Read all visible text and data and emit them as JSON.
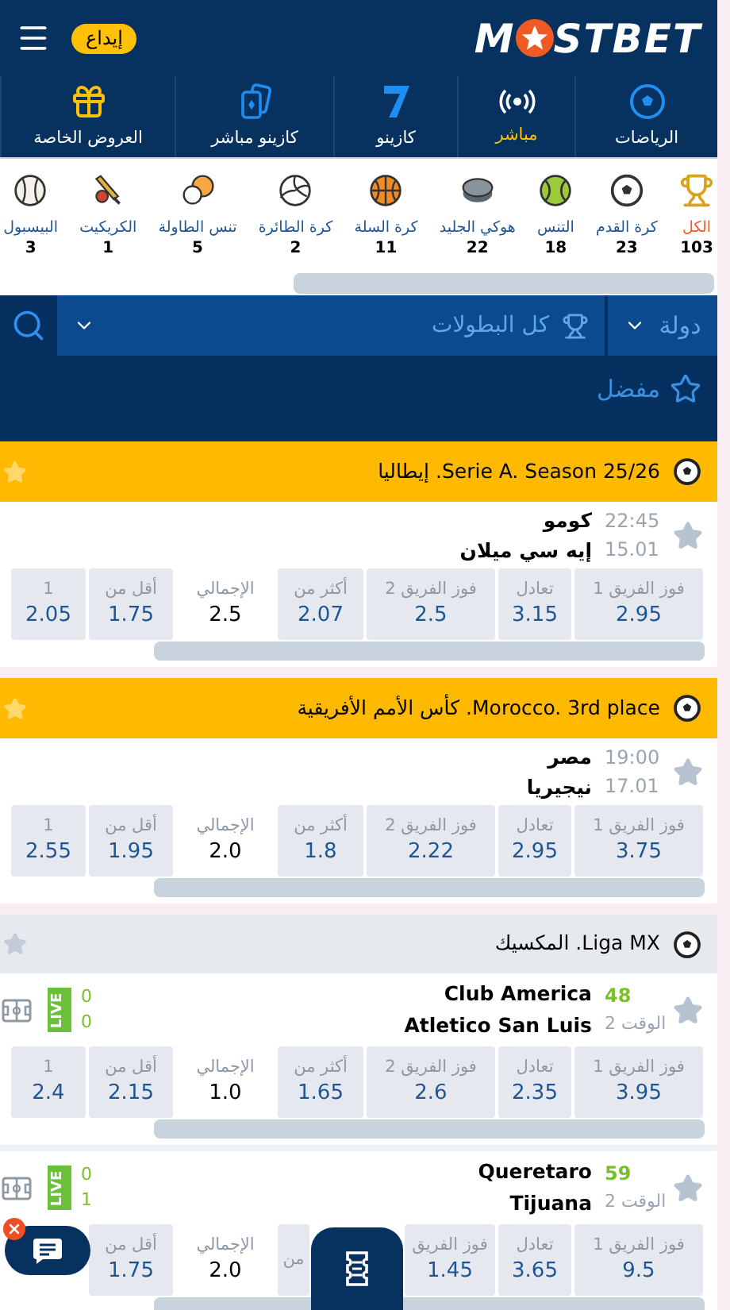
{
  "header": {
    "logo_left": "M",
    "logo_right": "STBET",
    "deposit_button": "إيداع"
  },
  "nav": [
    {
      "label": "الرياضات",
      "kind": "ball",
      "selected": false
    },
    {
      "label": "مباشر",
      "kind": "live",
      "selected": true
    },
    {
      "label": "كازينو",
      "kind": "seven",
      "selected": false
    },
    {
      "label": "كازينو مباشر",
      "kind": "cards",
      "selected": false
    },
    {
      "label": "العروض الخاصة",
      "kind": "gift",
      "selected": false
    }
  ],
  "sports": [
    {
      "label": "الكل",
      "count": "103",
      "kind": "trophy",
      "selected": true
    },
    {
      "label": "كرة القدم",
      "count": "23",
      "kind": "football",
      "selected": false
    },
    {
      "label": "التنس",
      "count": "18",
      "kind": "tennis",
      "selected": false
    },
    {
      "label": "هوكي الجليد",
      "count": "22",
      "kind": "hockey",
      "selected": false
    },
    {
      "label": "كرة السلة",
      "count": "11",
      "kind": "basketball",
      "selected": false
    },
    {
      "label": "كرة الطائرة",
      "count": "2",
      "kind": "volleyball",
      "selected": false
    },
    {
      "label": "تنس الطاولة",
      "count": "5",
      "kind": "pingpong",
      "selected": false
    },
    {
      "label": "الكريكيت",
      "count": "1",
      "kind": "cricket",
      "selected": false
    },
    {
      "label": "البيسبول",
      "count": "3",
      "kind": "baseball",
      "selected": false
    }
  ],
  "filters": {
    "country": "دولة",
    "tournaments": "كل البطولات"
  },
  "favorites": "مفضل",
  "leagues": [
    {
      "title": "Serie A. Season 25/26. إيطاليا",
      "highlight": true,
      "matches": [
        {
          "kind": "prematch",
          "time": "22:45",
          "date": "15.01",
          "team1": "كومو",
          "team2": "إيه سي ميلان",
          "odds": [
            {
              "label": "فوز الفريق 1",
              "value": "2.95",
              "kind": "odd"
            },
            {
              "label": "تعادل",
              "value": "3.15",
              "kind": "odd"
            },
            {
              "label": "فوز الفريق 2",
              "value": "2.5",
              "kind": "odd"
            },
            {
              "label": "أكثر من",
              "value": "2.07",
              "kind": "odd"
            },
            {
              "label": "الإجمالي",
              "value": "2.5",
              "kind": "total"
            },
            {
              "label": "أقل من",
              "value": "1.75",
              "kind": "odd"
            },
            {
              "label": "1",
              "value": "2.05",
              "kind": "odd"
            }
          ]
        }
      ]
    },
    {
      "title": "Morocco. 3rd place. كأس الأمم الأفريقية",
      "highlight": true,
      "matches": [
        {
          "kind": "prematch",
          "time": "19:00",
          "date": "17.01",
          "team1": "مصر",
          "team2": "نيجيريا",
          "odds": [
            {
              "label": "فوز الفريق 1",
              "value": "3.75",
              "kind": "odd"
            },
            {
              "label": "تعادل",
              "value": "2.95",
              "kind": "odd"
            },
            {
              "label": "فوز الفريق 2",
              "value": "2.22",
              "kind": "odd"
            },
            {
              "label": "أكثر من",
              "value": "1.8",
              "kind": "odd"
            },
            {
              "label": "الإجمالي",
              "value": "2.0",
              "kind": "total"
            },
            {
              "label": "أقل من",
              "value": "1.95",
              "kind": "odd"
            },
            {
              "label": "1",
              "value": "2.55",
              "kind": "odd"
            }
          ]
        }
      ]
    },
    {
      "title": "Liga MX. المكسيك",
      "highlight": false,
      "matches": [
        {
          "kind": "live",
          "minute": "48",
          "period": "الوقت 2",
          "team1": "Club America",
          "team2": "Atletico San Luis",
          "scores": [
            "0",
            "0"
          ],
          "badge": "LIVE",
          "odds": [
            {
              "label": "فوز الفريق 1",
              "value": "3.95",
              "kind": "odd"
            },
            {
              "label": "تعادل",
              "value": "2.35",
              "kind": "odd"
            },
            {
              "label": "فوز الفريق 2",
              "value": "2.6",
              "kind": "odd"
            },
            {
              "label": "أكثر من",
              "value": "1.65",
              "kind": "odd"
            },
            {
              "label": "الإجمالي",
              "value": "1.0",
              "kind": "total"
            },
            {
              "label": "أقل من",
              "value": "2.15",
              "kind": "odd"
            },
            {
              "label": "1",
              "value": "2.4",
              "kind": "odd"
            }
          ]
        },
        {
          "kind": "live",
          "minute": "59",
          "period": "الوقت 2",
          "team1": "Queretaro",
          "team2": "Tijuana",
          "scores": [
            "0",
            "1"
          ],
          "badge": "LIVE",
          "odds": [
            {
              "label": "فوز الفريق 1",
              "value": "9.5",
              "kind": "odd"
            },
            {
              "label": "تعادل",
              "value": "3.65",
              "kind": "odd"
            },
            {
              "label": "فوز الفريق",
              "value": "1.45",
              "kind": "odd",
              "cut_left": true
            },
            {
              "label": "من",
              "kind": "odd",
              "cut_right": true
            },
            {
              "label": "الإجمالي",
              "value": "2.0",
              "kind": "total"
            },
            {
              "label": "أقل من",
              "value": "1.75",
              "kind": "odd"
            }
          ]
        }
      ]
    }
  ]
}
